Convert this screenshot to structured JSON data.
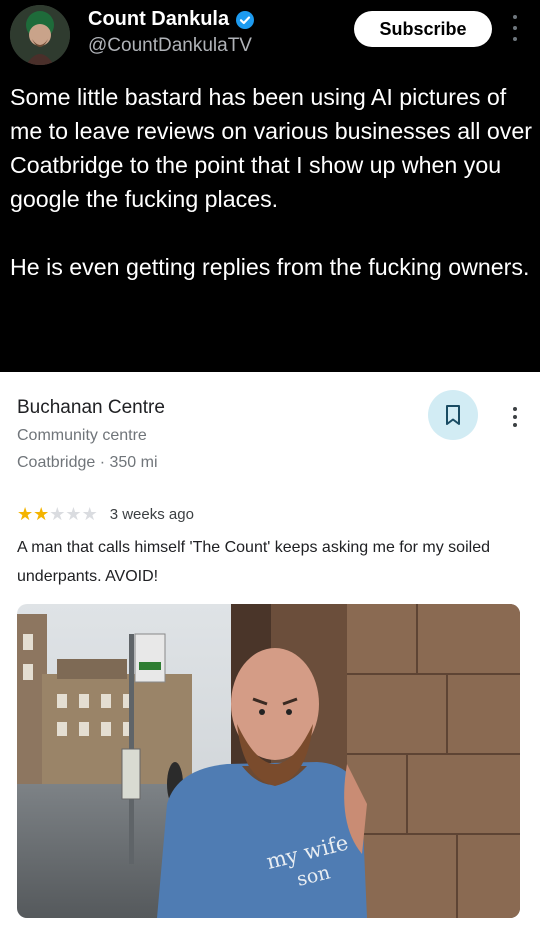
{
  "tweet": {
    "author_name": "Count Dankula",
    "handle": "@CountDankulaTV",
    "subscribe_label": "Subscribe",
    "text": "Some little bastard has been using AI pictures of me to leave reviews on various businesses all over Coatbridge to the point that I show up when you google the fucking places.\n\nHe is even getting replies from the fucking owners.",
    "verified_icon": "verified-badge-icon"
  },
  "review_card": {
    "place_name": "Buchanan Centre",
    "category": "Community centre",
    "location": "Coatbridge · 350 mi",
    "rating": 2,
    "rating_max": 5,
    "time_ago": "3 weeks ago",
    "review_text": "A man that calls himself 'The Count' keeps asking me for my soiled underpants. AVOID!",
    "photo_shirt_text_line1": "my wife",
    "photo_shirt_text_line2": "son",
    "icons": [
      "bookmark-icon",
      "more-vert-icon"
    ]
  },
  "colors": {
    "tweet_bg": "#000000",
    "star_filled": "#f4b400",
    "star_empty": "#dadce0",
    "save_button_bg": "#d2ecf4",
    "verified": "#1d9bf0"
  }
}
